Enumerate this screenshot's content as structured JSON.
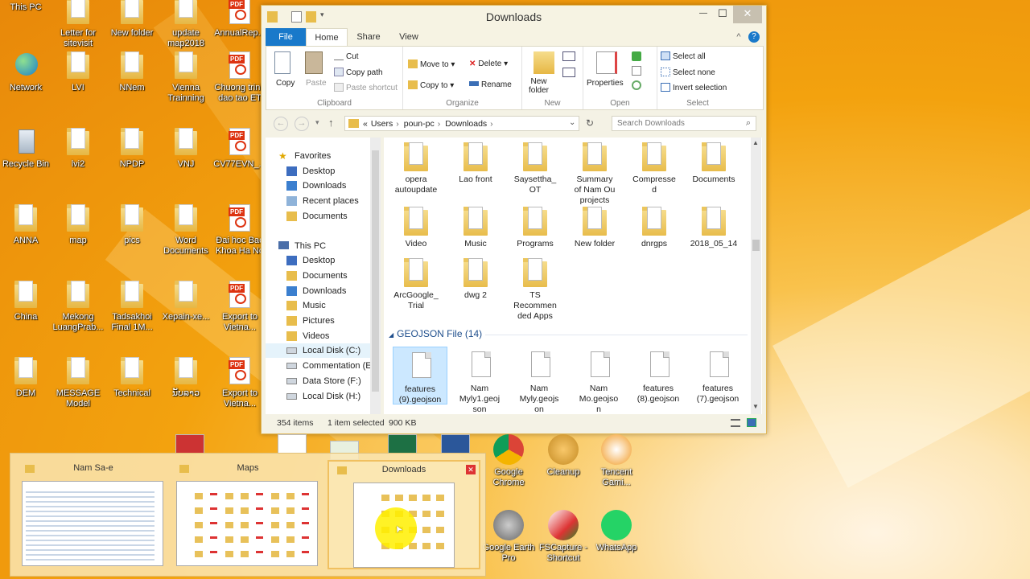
{
  "desktop": {
    "icons": [
      {
        "label": "This PC"
      },
      {
        "label": "Letter for\nsitevisit"
      },
      {
        "label": "New folder"
      },
      {
        "label": "update\nmap2018"
      },
      {
        "label": "AnnualRep..."
      },
      {
        "label": "Network"
      },
      {
        "label": "LVI"
      },
      {
        "label": "NNem"
      },
      {
        "label": "Vienna\nTrainning"
      },
      {
        "label": "Chuong trinh\ndao tao ET"
      },
      {
        "label": "Recycle Bin"
      },
      {
        "label": "lvi2"
      },
      {
        "label": "NPDP"
      },
      {
        "label": "VNJ"
      },
      {
        "label": "CV77EVN_..."
      },
      {
        "label": "ANNA"
      },
      {
        "label": "map"
      },
      {
        "label": "pics"
      },
      {
        "label": "Word\nDocuments"
      },
      {
        "label": "Đai hoc Bac\nKhoa Ha No"
      },
      {
        "label": "China"
      },
      {
        "label": "Mekong\nLuangPrab..."
      },
      {
        "label": "Tadsakhoi\nFinal 1M..."
      },
      {
        "label": "Xepain-xe..."
      },
      {
        "label": "Export to\nVietna..."
      },
      {
        "label": "DEM"
      },
      {
        "label": "MESSAGE\nModel"
      },
      {
        "label": "Technical"
      },
      {
        "label": "ນັບລາວ"
      },
      {
        "label": "Export to\nVietna..."
      }
    ],
    "bottom_icons": [
      {
        "label": "Google\nChrome"
      },
      {
        "label": "Cleanup"
      },
      {
        "label": "Tencent\nGami..."
      },
      {
        "label": "Google Earth\nPro"
      },
      {
        "label": "FSCapture -\nShortcut"
      },
      {
        "label": "WhatsApp"
      }
    ]
  },
  "window": {
    "title": "Downloads",
    "minimize": "—",
    "maximize": "☐",
    "close": "✕",
    "tabs": {
      "file": "File",
      "home": "Home",
      "share": "Share",
      "view": "View"
    },
    "ribbon": {
      "clipboard": {
        "copy": "Copy",
        "paste": "Paste",
        "cut": "Cut",
        "copy_path": "Copy path",
        "paste_shortcut": "Paste shortcut",
        "label": "Clipboard"
      },
      "organize": {
        "move_to": "Move to",
        "copy_to": "Copy to",
        "delete": "Delete",
        "rename": "Rename",
        "label": "Organize"
      },
      "new": {
        "new_folder": "New\nfolder",
        "label": "New"
      },
      "open": {
        "properties": "Properties",
        "label": "Open"
      },
      "select": {
        "select_all": "Select all",
        "select_none": "Select none",
        "invert": "Invert selection",
        "label": "Select"
      }
    },
    "address": {
      "parts": [
        "«",
        "Users",
        "poun-pc",
        "Downloads"
      ],
      "search_placeholder": "Search Downloads"
    },
    "nav": {
      "favorites": "Favorites",
      "fav_items": [
        "Desktop",
        "Downloads",
        "Recent places",
        "Documents"
      ],
      "this_pc": "This PC",
      "pc_items": [
        "Desktop",
        "Documents",
        "Downloads",
        "Music",
        "Pictures",
        "Videos",
        "Local Disk (C:)",
        "Commentation (E:",
        "Data Store (F:)",
        "Local Disk (H:)"
      ]
    },
    "folders": [
      {
        "name": "opera\nautoupdate"
      },
      {
        "name": "Lao front"
      },
      {
        "name": "Saysettha_\nOT"
      },
      {
        "name": "Summary\nof Nam Ou\nprojects"
      },
      {
        "name": "Compresse\nd"
      },
      {
        "name": "Documents"
      },
      {
        "name": "Video"
      },
      {
        "name": "Music"
      },
      {
        "name": "Programs"
      },
      {
        "name": "New folder"
      },
      {
        "name": "dnrgps"
      },
      {
        "name": "2018_05_14"
      },
      {
        "name": "ArcGoogle_\nTrial"
      },
      {
        "name": "dwg 2"
      },
      {
        "name": "TS\nRecommen\nded Apps"
      }
    ],
    "group_header": "GEOJSON File (14)",
    "files": [
      {
        "name": "features\n(9).geojson"
      },
      {
        "name": "Nam\nMyly1.geoj\nson"
      },
      {
        "name": "Nam\nMyly.geojs\non"
      },
      {
        "name": "Nam\nMo.geojso\nn"
      },
      {
        "name": "features\n(8).geojson"
      },
      {
        "name": "features\n(7).geojson"
      }
    ],
    "status": {
      "count": "354 items",
      "selected": "1 item selected",
      "size": "900 KB"
    }
  },
  "switcher": {
    "cards": [
      {
        "title": "Nam Sa-e"
      },
      {
        "title": "Maps"
      },
      {
        "title": "Downloads"
      }
    ],
    "close": "✕"
  },
  "colors": {
    "accent": "#1979ca",
    "selection": "#cce8ff",
    "folder": "#e8bd4c",
    "pdf": "#d31f1f"
  }
}
